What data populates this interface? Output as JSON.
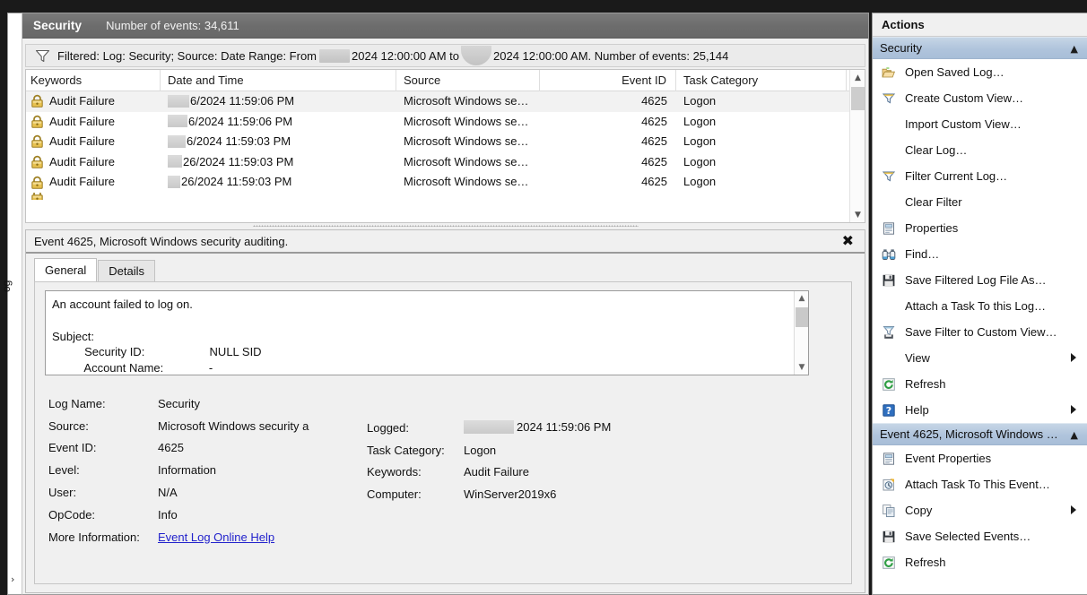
{
  "left_rail": {
    "label": "og",
    "expander": "›"
  },
  "log_view": {
    "title": "Security",
    "event_count_label": "Number of events: 34,611",
    "filter": {
      "icon": "filter-icon",
      "prefix": "Filtered: Log: Security; Source: Date Range: From",
      "from_date": "2024 12:00:00 AM to",
      "to_date": "2024 12:00:00 AM. Number of events: 25,144"
    },
    "columns": [
      "Keywords",
      "Date and Time",
      "Source",
      "Event ID",
      "Task Category"
    ],
    "rows": [
      {
        "keywords": "Audit Failure",
        "date": "6/2024 11:59:06 PM",
        "source": "Microsoft Windows se…",
        "event_id": "4625",
        "task": "Logon",
        "redact_w": 24,
        "selected": true
      },
      {
        "keywords": "Audit Failure",
        "date": "6/2024 11:59:06 PM",
        "source": "Microsoft Windows se…",
        "event_id": "4625",
        "task": "Logon",
        "redact_w": 22,
        "selected": false
      },
      {
        "keywords": "Audit Failure",
        "date": "6/2024 11:59:03 PM",
        "source": "Microsoft Windows se…",
        "event_id": "4625",
        "task": "Logon",
        "redact_w": 20,
        "selected": false
      },
      {
        "keywords": "Audit Failure",
        "date": "26/2024 11:59:03 PM",
        "source": "Microsoft Windows se…",
        "event_id": "4625",
        "task": "Logon",
        "redact_w": 16,
        "selected": false
      },
      {
        "keywords": "Audit Failure",
        "date": "26/2024 11:59:03 PM",
        "source": "Microsoft Windows se…",
        "event_id": "4625",
        "task": "Logon",
        "redact_w": 14,
        "selected": false
      }
    ]
  },
  "detail": {
    "title": "Event 4625, Microsoft Windows security auditing.",
    "close_label": "✖",
    "tabs": [
      {
        "label": "General",
        "active": true
      },
      {
        "label": "Details",
        "active": false
      }
    ],
    "description": "An account failed to log on.\n\nSubject:\n          Security ID:                    NULL SID\n          Account Name:              -\n          Account Domain:",
    "fields_left": [
      {
        "label": "Log Name:",
        "value": "Security"
      },
      {
        "label": "Source:",
        "value": "Microsoft Windows security a"
      },
      {
        "label": "Event ID:",
        "value": "4625"
      },
      {
        "label": "Level:",
        "value": "Information"
      },
      {
        "label": "User:",
        "value": "N/A"
      },
      {
        "label": "OpCode:",
        "value": "Info"
      }
    ],
    "more_information_label": "More Information:",
    "more_information_link": "Event Log Online Help",
    "fields_right": [
      {
        "label": "Logged:",
        "value": "2024 11:59:06 PM",
        "redacted": true
      },
      {
        "label": "Task Category:",
        "value": "Logon",
        "redacted": false
      },
      {
        "label": "Keywords:",
        "value": "Audit Failure",
        "redacted": false
      },
      {
        "label": "Computer:",
        "value": "WinServer2019x6",
        "redacted": false
      }
    ]
  },
  "actions": {
    "header": "Actions",
    "sections": [
      {
        "title": "Security",
        "collapse_caret": "▲",
        "items": [
          {
            "label": "Open Saved Log…",
            "icon": "open-folder-icon",
            "submenu": false
          },
          {
            "label": "Create Custom View…",
            "icon": "filter-icon",
            "submenu": false
          },
          {
            "label": "Import Custom View…",
            "icon": "none",
            "submenu": false
          },
          {
            "label": "Clear Log…",
            "icon": "none",
            "submenu": false
          },
          {
            "label": "Filter Current Log…",
            "icon": "filter-icon",
            "submenu": false
          },
          {
            "label": "Clear Filter",
            "icon": "none",
            "submenu": false
          },
          {
            "label": "Properties",
            "icon": "properties-icon",
            "submenu": false
          },
          {
            "label": "Find…",
            "icon": "binoculars-icon",
            "submenu": false
          },
          {
            "label": "Save Filtered Log File As…",
            "icon": "save-disk-icon",
            "submenu": false
          },
          {
            "label": "Attach a Task To this Log…",
            "icon": "none",
            "submenu": false
          },
          {
            "label": "Save Filter to Custom View…",
            "icon": "save-filter-icon",
            "submenu": false
          },
          {
            "label": "View",
            "icon": "none",
            "submenu": true
          },
          {
            "label": "Refresh",
            "icon": "refresh-icon",
            "submenu": false
          },
          {
            "label": "Help",
            "icon": "help-icon",
            "submenu": true
          }
        ]
      },
      {
        "title": "Event 4625, Microsoft Windows …",
        "collapse_caret": "▲",
        "items": [
          {
            "label": "Event Properties",
            "icon": "properties-icon",
            "submenu": false
          },
          {
            "label": "Attach Task To This Event…",
            "icon": "attach-task-icon",
            "submenu": false
          },
          {
            "label": "Copy",
            "icon": "copy-icon",
            "submenu": true
          },
          {
            "label": "Save Selected Events…",
            "icon": "save-disk-icon",
            "submenu": false
          },
          {
            "label": "Refresh",
            "icon": "refresh-icon",
            "submenu": false
          }
        ]
      }
    ]
  },
  "colors": {
    "titlebar": "#6d6d6d",
    "section_header": "#b0c4dc",
    "link": "#2222cc",
    "selected_row": "#f2f2f2"
  }
}
